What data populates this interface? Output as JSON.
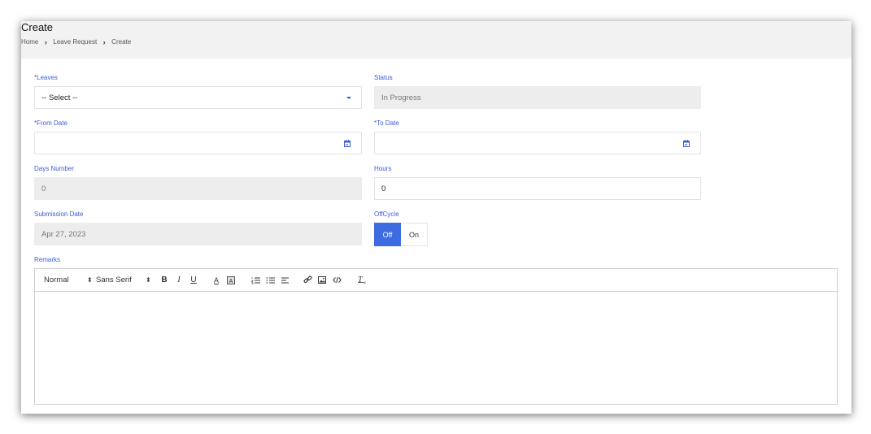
{
  "header": {
    "title": "Create",
    "breadcrumb": [
      "Home",
      "Leave Request",
      "Create"
    ]
  },
  "form": {
    "leaves": {
      "label": "*Leaves",
      "value": "-- Select --"
    },
    "status": {
      "label": "Status",
      "value": "In Progress"
    },
    "from_date": {
      "label": "*From Date",
      "value": ""
    },
    "to_date": {
      "label": "*To Date",
      "value": ""
    },
    "days_number": {
      "label": "Days Number",
      "value": "0"
    },
    "hours": {
      "label": "Hours",
      "value": "0"
    },
    "submission_date": {
      "label": "Submission Date",
      "value": "Apr 27, 2023"
    },
    "offcycle": {
      "label": "OffCycle",
      "off_label": "Off",
      "on_label": "On",
      "selected": "Off"
    },
    "remarks": {
      "label": "Remarks"
    }
  },
  "editor": {
    "heading_picker": "Normal",
    "font_picker": "Sans Serif",
    "tools": [
      "bold-icon",
      "italic-icon",
      "underline-icon",
      "font-color-icon",
      "background-color-icon",
      "ordered-list-icon",
      "bullet-list-icon",
      "align-icon",
      "link-icon",
      "image-icon",
      "code-icon",
      "clear-format-icon"
    ]
  },
  "colors": {
    "accent": "#3d6be0",
    "label": "#3d5bd8",
    "readonly_bg": "#ededed",
    "header_bg": "#f2f2f2"
  }
}
